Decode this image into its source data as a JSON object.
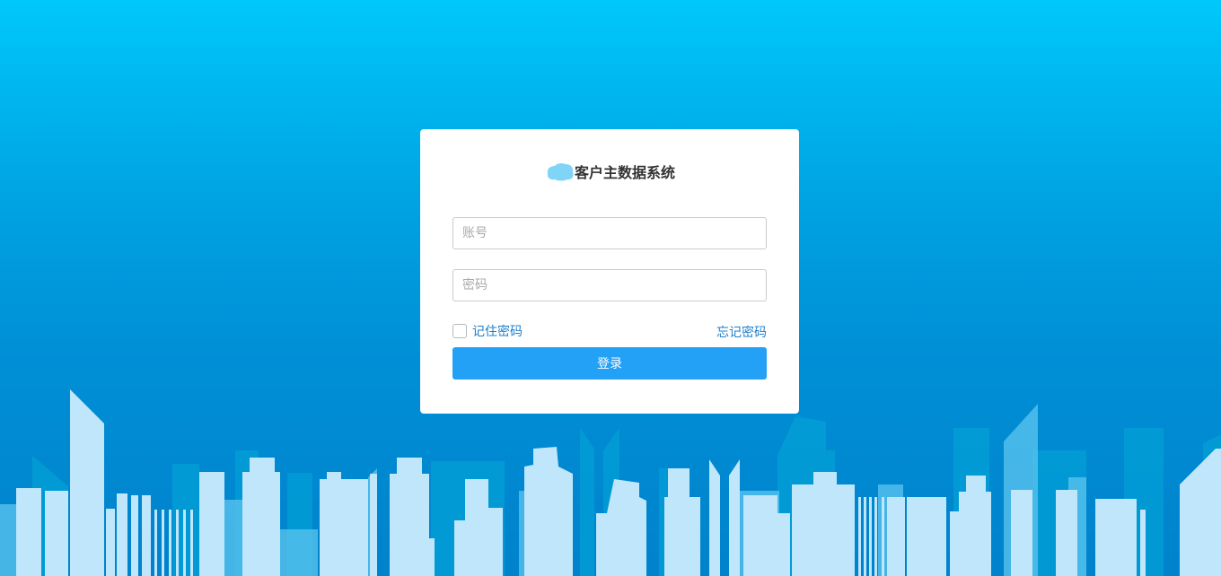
{
  "app": {
    "title": "客户主数据系统"
  },
  "login": {
    "account_placeholder": "账号",
    "password_placeholder": "密码",
    "remember_label": "记住密码",
    "forgot_label": "忘记密码",
    "submit_label": "登录"
  },
  "colors": {
    "background_top": "#00c8fb",
    "background_bottom": "#0082cc",
    "primary_button": "#22a1f6",
    "link": "#1e7fc9",
    "logo": "#7fd4f8",
    "building_light": "#bfe6fb",
    "building_mid": "#5cc6ef",
    "building_dark": "#019fd8"
  },
  "icons": {
    "logo": "cloud-logo-icon"
  }
}
